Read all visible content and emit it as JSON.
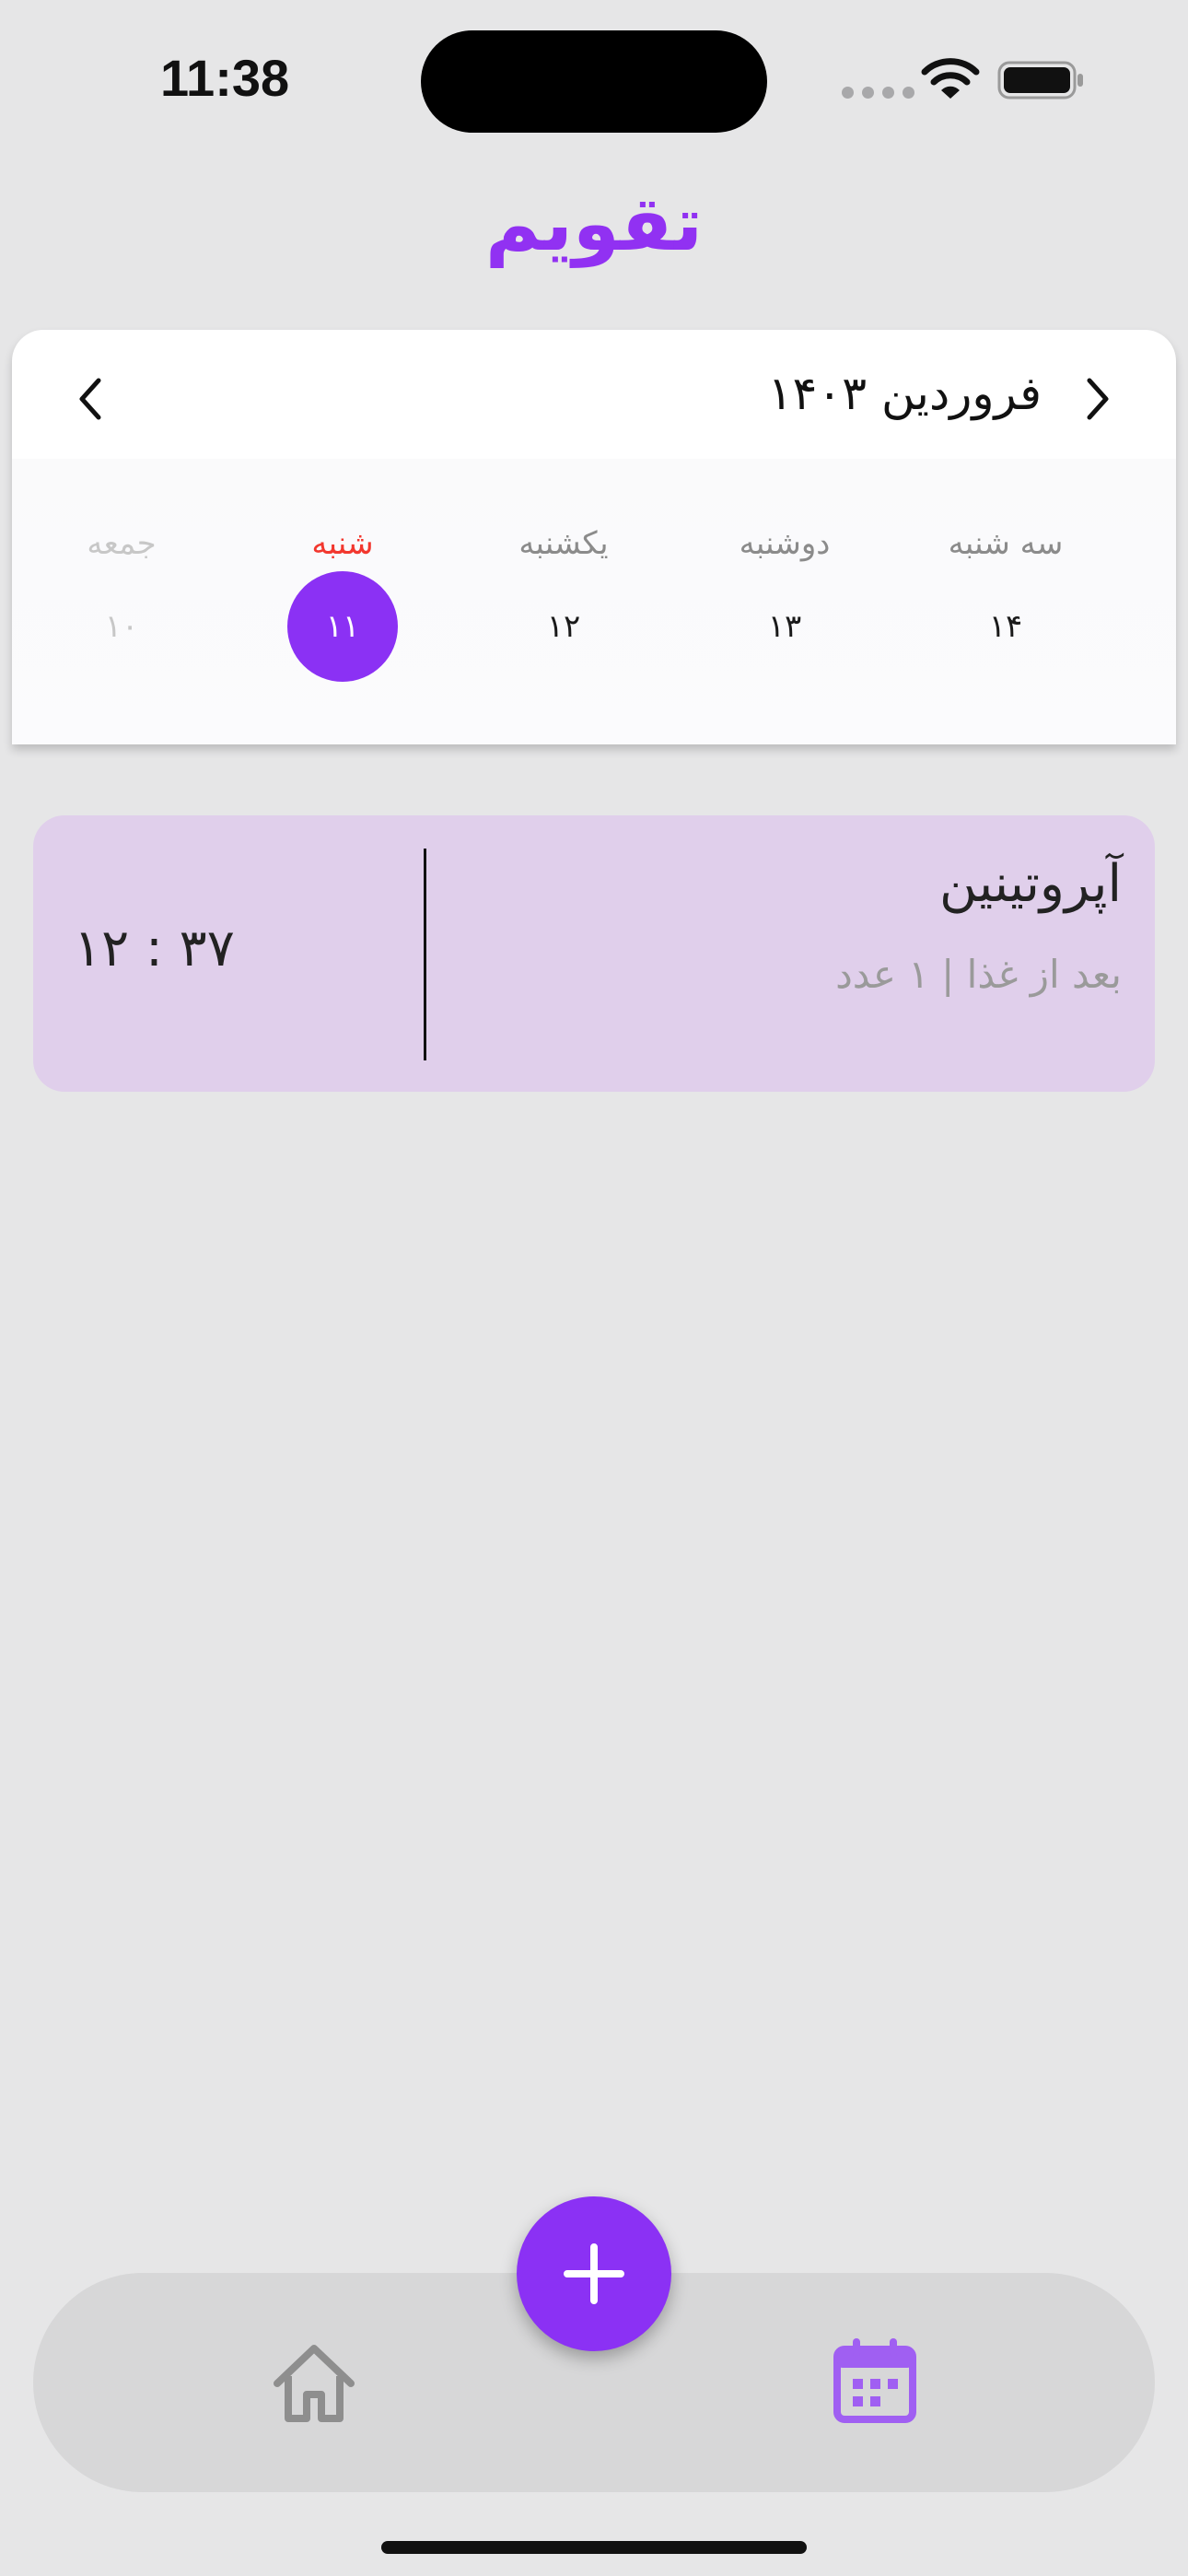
{
  "status_bar": {
    "time": "11:38"
  },
  "header": {
    "title": "تقویم"
  },
  "calendar": {
    "month_label": "فروردین ۱۴۰۳",
    "days": [
      {
        "name": "سه شنبه",
        "number": "۱۴",
        "state": "normal"
      },
      {
        "name": "دوشنبه",
        "number": "۱۳",
        "state": "normal"
      },
      {
        "name": "یکشنبه",
        "number": "۱۲",
        "state": "normal"
      },
      {
        "name": "شنبه",
        "number": "۱۱",
        "state": "selected"
      },
      {
        "name": "جمعه",
        "number": "۱۰",
        "state": "faded"
      }
    ]
  },
  "medications": [
    {
      "name": "آپروتینین",
      "detail": "بعد از غذا | ۱ عدد",
      "time": "۱۲ : ۳۷"
    }
  ],
  "bottom_nav": {
    "items": [
      {
        "icon": "home-icon",
        "active": false
      },
      {
        "icon": "calendar-icon",
        "active": true
      }
    ],
    "fab_icon": "plus-icon"
  },
  "colors": {
    "accent": "#8b31f4",
    "title": "#9131f2",
    "selected_day_label": "#f2372e",
    "med_card_bg": "#e0cfeb",
    "background": "#e6e6e7"
  }
}
